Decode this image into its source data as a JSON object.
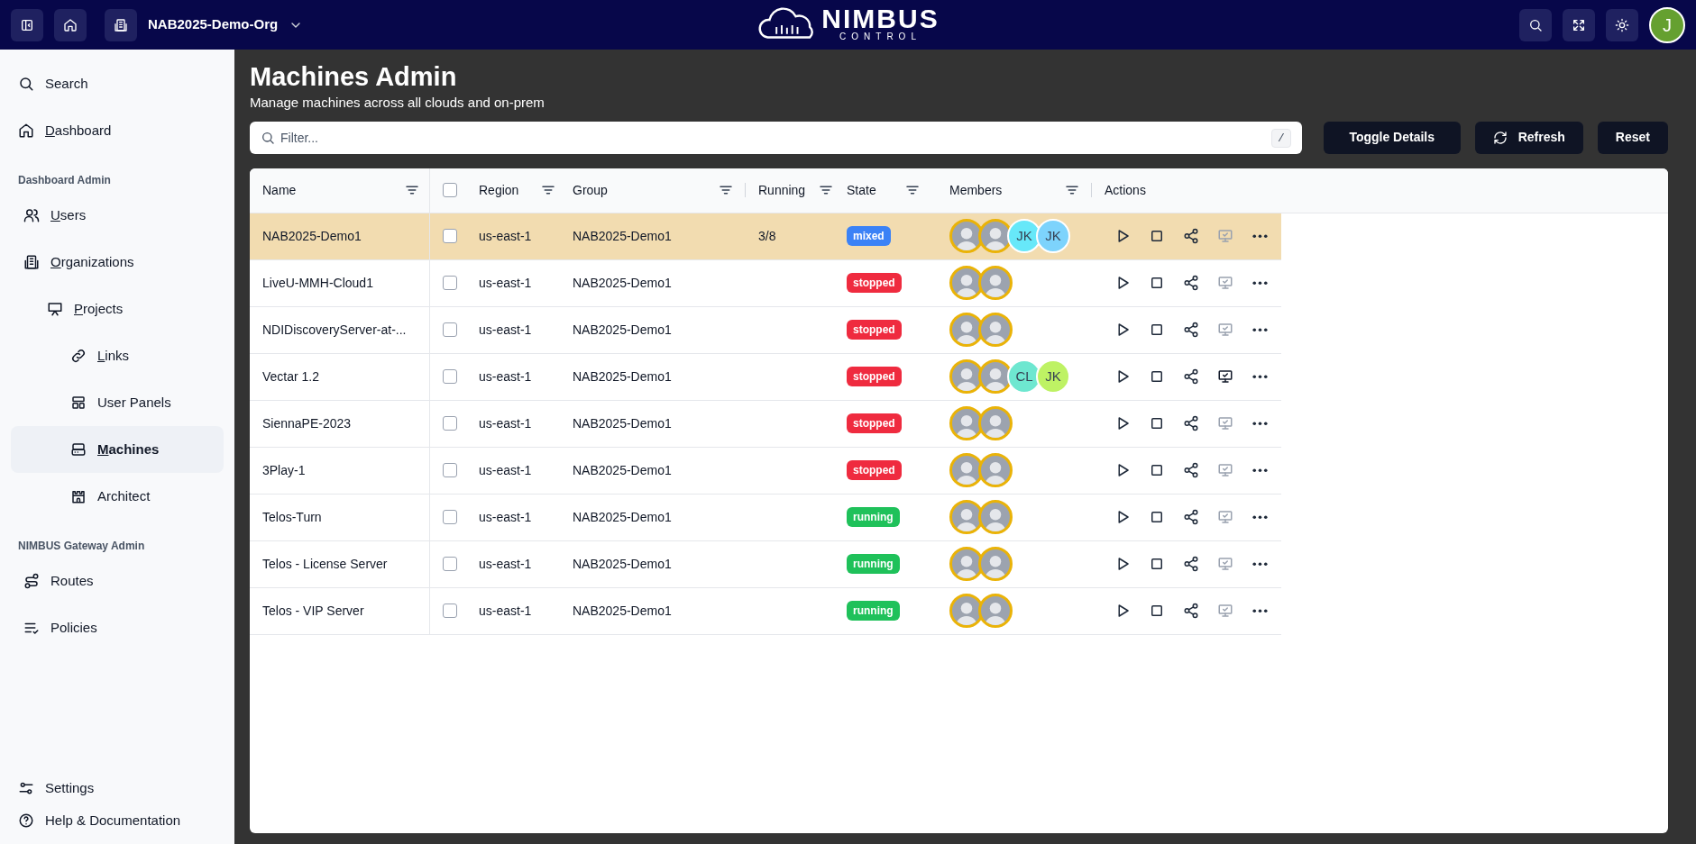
{
  "topbar": {
    "org": "NAB2025-Demo-Org",
    "logo": {
      "name": "NIMBUS",
      "tagline": "CONTROL"
    },
    "user_initial": "J"
  },
  "sidebar": {
    "top": [
      {
        "label": "Search",
        "underline_first": false,
        "selected": false
      },
      {
        "label": "Dashboard",
        "underline_first": true,
        "selected": false
      }
    ],
    "sections": [
      {
        "title": "Dashboard Admin",
        "items": [
          {
            "label": "Users",
            "underline_first": true,
            "selected": false
          },
          {
            "label": "Organizations",
            "underline_first": true,
            "selected": false,
            "children": [
              {
                "label": "Projects",
                "underline_first": true,
                "selected": false,
                "children": [
                  {
                    "label": "Links",
                    "underline_first": true,
                    "selected": false
                  },
                  {
                    "label": "User Panels",
                    "underline_first": false,
                    "selected": false
                  },
                  {
                    "label": "Machines",
                    "underline_first": true,
                    "selected": true
                  },
                  {
                    "label": "Architect",
                    "underline_first": false,
                    "selected": false
                  }
                ]
              }
            ]
          }
        ]
      },
      {
        "title": "NIMBUS Gateway Admin",
        "items": [
          {
            "label": "Routes",
            "underline_first": false,
            "selected": false
          },
          {
            "label": "Policies",
            "underline_first": false,
            "selected": false
          }
        ]
      }
    ],
    "bottom": [
      {
        "label": "Settings"
      },
      {
        "label": "Help & Documentation"
      }
    ]
  },
  "page": {
    "title": "Machines Admin",
    "subtitle": "Manage machines across all clouds and on-prem"
  },
  "filter": {
    "placeholder": "Filter...",
    "shortcut": "/"
  },
  "buttons": [
    "Toggle Details",
    "Refresh",
    "Reset"
  ],
  "table": {
    "columns": [
      "Name",
      "Region",
      "Group",
      "Running",
      "State",
      "Members",
      "Actions"
    ],
    "header_checkbox": {
      "checked": false
    },
    "rows": [
      {
        "name": "NAB2025-Demo1",
        "selected": true,
        "checked": false,
        "region": "us-east-1",
        "group": "NAB2025-Demo1",
        "running": "3/8",
        "state": {
          "label": "mixed",
          "kind": "mixed"
        },
        "members": [
          {
            "kind": "photo"
          },
          {
            "kind": "photo"
          },
          {
            "kind": "initials",
            "initials": "JK",
            "color": "#67e8f9"
          },
          {
            "kind": "initials",
            "initials": "JK",
            "color": "#7dd3fc"
          }
        ],
        "desktop_enabled": false
      },
      {
        "name": "LiveU-MMH-Cloud1",
        "selected": false,
        "checked": false,
        "region": "us-east-1",
        "group": "NAB2025-Demo1",
        "state": {
          "label": "stopped",
          "kind": "stopped"
        },
        "members": [
          {
            "kind": "photo"
          },
          {
            "kind": "photo"
          }
        ],
        "desktop_enabled": false
      },
      {
        "name": "NDIDiscoveryServer-at-...",
        "selected": false,
        "checked": false,
        "region": "us-east-1",
        "group": "NAB2025-Demo1",
        "state": {
          "label": "stopped",
          "kind": "stopped"
        },
        "members": [
          {
            "kind": "photo"
          },
          {
            "kind": "photo"
          }
        ],
        "desktop_enabled": false
      },
      {
        "name": "Vectar 1.2",
        "selected": false,
        "checked": false,
        "region": "us-east-1",
        "group": "NAB2025-Demo1",
        "state": {
          "label": "stopped",
          "kind": "stopped"
        },
        "members": [
          {
            "kind": "photo"
          },
          {
            "kind": "photo"
          },
          {
            "kind": "initials",
            "initials": "CL",
            "color": "#6ee7d0"
          },
          {
            "kind": "initials",
            "initials": "JK",
            "color": "#bef264"
          }
        ],
        "desktop_enabled": true
      },
      {
        "name": "SiennaPE-2023",
        "selected": false,
        "checked": false,
        "region": "us-east-1",
        "group": "NAB2025-Demo1",
        "state": {
          "label": "stopped",
          "kind": "stopped"
        },
        "members": [
          {
            "kind": "photo"
          },
          {
            "kind": "photo"
          }
        ],
        "desktop_enabled": false
      },
      {
        "name": "3Play-1",
        "selected": false,
        "checked": false,
        "region": "us-east-1",
        "group": "NAB2025-Demo1",
        "state": {
          "label": "stopped",
          "kind": "stopped"
        },
        "members": [
          {
            "kind": "photo"
          },
          {
            "kind": "photo"
          }
        ],
        "desktop_enabled": false
      },
      {
        "name": "Telos-Turn",
        "selected": false,
        "checked": false,
        "region": "us-east-1",
        "group": "NAB2025-Demo1",
        "state": {
          "label": "running",
          "kind": "running"
        },
        "members": [
          {
            "kind": "photo"
          },
          {
            "kind": "photo"
          }
        ],
        "desktop_enabled": false
      },
      {
        "name": "Telos - License Server",
        "selected": false,
        "checked": false,
        "region": "us-east-1",
        "group": "NAB2025-Demo1",
        "state": {
          "label": "running",
          "kind": "running"
        },
        "members": [
          {
            "kind": "photo"
          },
          {
            "kind": "photo"
          }
        ],
        "desktop_enabled": false
      },
      {
        "name": "Telos - VIP Server",
        "selected": false,
        "checked": false,
        "region": "us-east-1",
        "group": "NAB2025-Demo1",
        "state": {
          "label": "running",
          "kind": "running"
        },
        "members": [
          {
            "kind": "photo"
          },
          {
            "kind": "photo"
          }
        ],
        "desktop_enabled": false
      }
    ]
  }
}
